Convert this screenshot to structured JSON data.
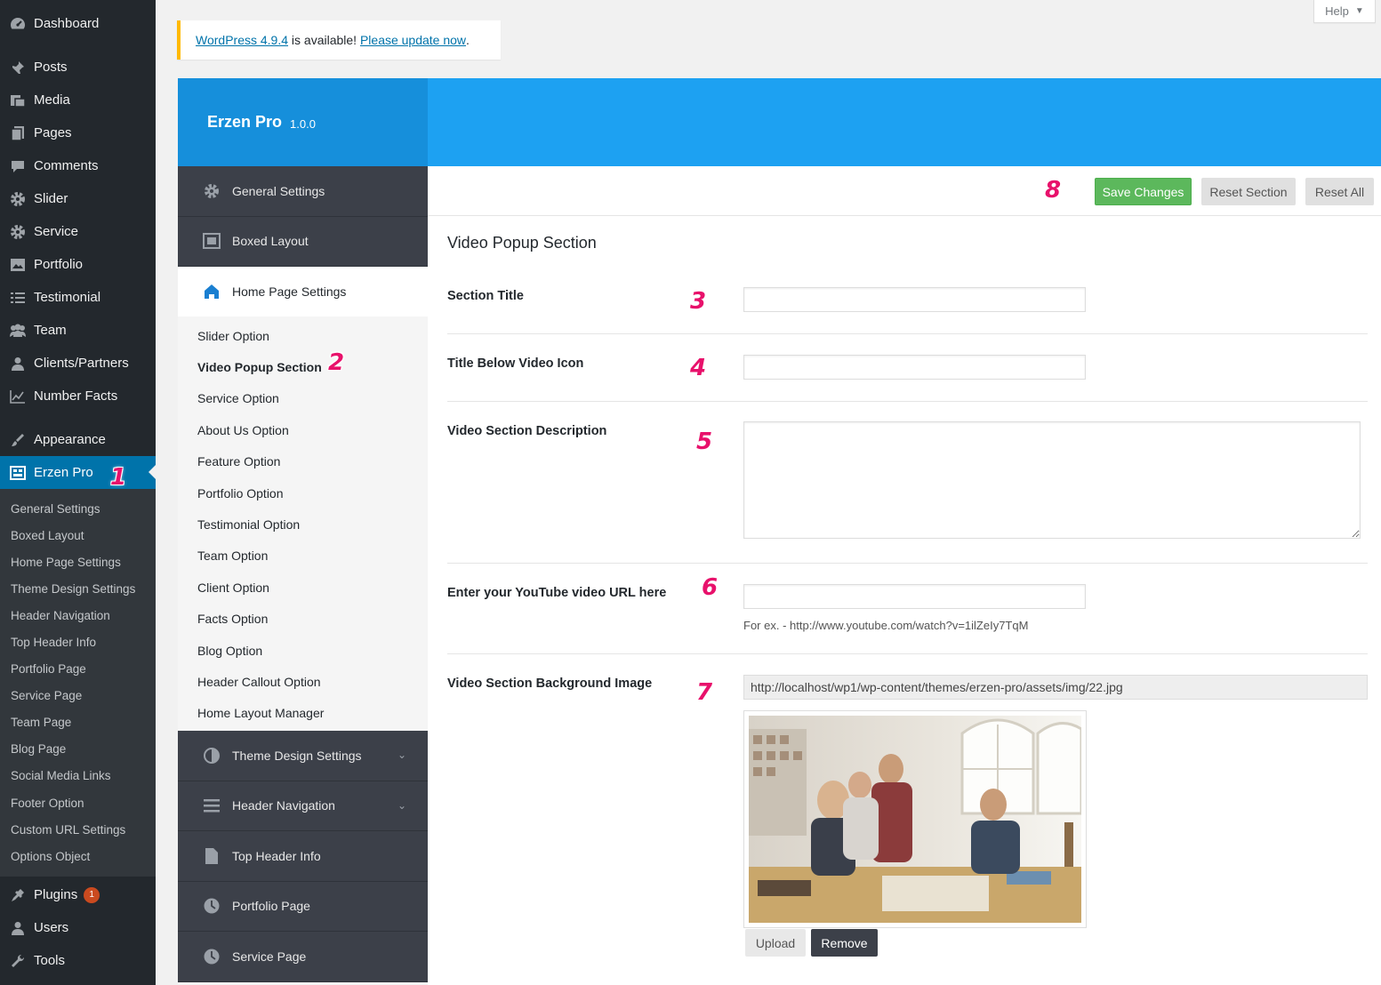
{
  "wp_menu": {
    "top": [
      {
        "label": "Dashboard",
        "icon": "dashboard-icon"
      }
    ],
    "main": [
      {
        "label": "Posts",
        "icon": "pin-icon"
      },
      {
        "label": "Media",
        "icon": "media-icon"
      },
      {
        "label": "Pages",
        "icon": "pages-icon"
      },
      {
        "label": "Comments",
        "icon": "comment-icon"
      },
      {
        "label": "Slider",
        "icon": "gear-icon"
      },
      {
        "label": "Service",
        "icon": "gear-icon"
      },
      {
        "label": "Portfolio",
        "icon": "portfolio-icon"
      },
      {
        "label": "Testimonial",
        "icon": "list-icon"
      },
      {
        "label": "Team",
        "icon": "team-icon"
      },
      {
        "label": "Clients/Partners",
        "icon": "user-icon"
      },
      {
        "label": "Number Facts",
        "icon": "chart-icon"
      }
    ],
    "appearance": {
      "label": "Appearance",
      "icon": "brush-icon"
    },
    "active": {
      "label": "Erzen Pro",
      "icon": "panel-icon"
    },
    "submenu": [
      "General Settings",
      "Boxed Layout",
      "Home Page Settings",
      "Theme Design Settings",
      "Header Navigation",
      "Top Header Info",
      "Portfolio Page",
      "Service Page",
      "Team Page",
      "Blog Page",
      "Social Media Links",
      "Footer Option",
      "Custom URL Settings",
      "Options Object"
    ],
    "bottom": [
      {
        "label": "Plugins",
        "icon": "plugin-icon",
        "badge": "1"
      },
      {
        "label": "Users",
        "icon": "user-icon"
      },
      {
        "label": "Tools",
        "icon": "wrench-icon"
      }
    ]
  },
  "help": {
    "label": "Help"
  },
  "notice": {
    "link1": "WordPress 4.9.4",
    "middle": " is available! ",
    "link2": "Please update now",
    "end": "."
  },
  "brand": {
    "name": "Erzen Pro",
    "version": "1.0.0"
  },
  "options_nav": {
    "top": [
      {
        "label": "General Settings",
        "icon": "gear-icon"
      },
      {
        "label": "Boxed Layout",
        "icon": "boxed-layout-icon"
      }
    ],
    "active": {
      "label": "Home Page Settings",
      "icon": "home-icon"
    },
    "subs": [
      "Slider Option",
      "Video Popup Section",
      "Service Option",
      "About Us Option",
      "Feature Option",
      "Portfolio Option",
      "Testimonial Option",
      "Team Option",
      "Client Option",
      "Facts Option",
      "Blog Option",
      "Header Callout Option",
      "Home Layout Manager"
    ],
    "current_sub_index": 1,
    "bottom": [
      {
        "label": "Theme Design Settings",
        "icon": "contrast-icon",
        "chevron": true
      },
      {
        "label": "Header Navigation",
        "icon": "menu-icon",
        "chevron": true
      },
      {
        "label": "Top Header Info",
        "icon": "document-icon",
        "chevron": false
      },
      {
        "label": "Portfolio Page",
        "icon": "circle-icon",
        "chevron": false
      },
      {
        "label": "Service Page",
        "icon": "circle-icon",
        "chevron": false
      }
    ]
  },
  "actions": {
    "save": "Save Changes",
    "reset_section": "Reset Section",
    "reset_all": "Reset All"
  },
  "section": {
    "title": "Video Popup Section",
    "fields": {
      "section_title": {
        "label": "Section Title",
        "value": ""
      },
      "title_below": {
        "label": "Title Below Video Icon",
        "value": ""
      },
      "description": {
        "label": "Video Section Description",
        "value": ""
      },
      "youtube": {
        "label": "Enter your YouTube video URL here",
        "value": "",
        "hint": "For ex. - http://www.youtube.com/watch?v=1ilZeIy7TqM"
      },
      "background": {
        "label": "Video Section Background Image",
        "url": "http://localhost/wp1/wp-content/themes/erzen-pro/assets/img/22.jpg",
        "upload": "Upload",
        "remove": "Remove"
      }
    }
  },
  "markers": [
    "1",
    "2",
    "3",
    "4",
    "5",
    "6",
    "7",
    "8"
  ],
  "colors": {
    "wp_sidebar": "#23282d",
    "wp_active": "#0073aa",
    "header_blue": "#1da1f2",
    "nav_dark": "#3c4049",
    "save_green": "#5cb85c",
    "marker_pink": "#e8116b"
  }
}
